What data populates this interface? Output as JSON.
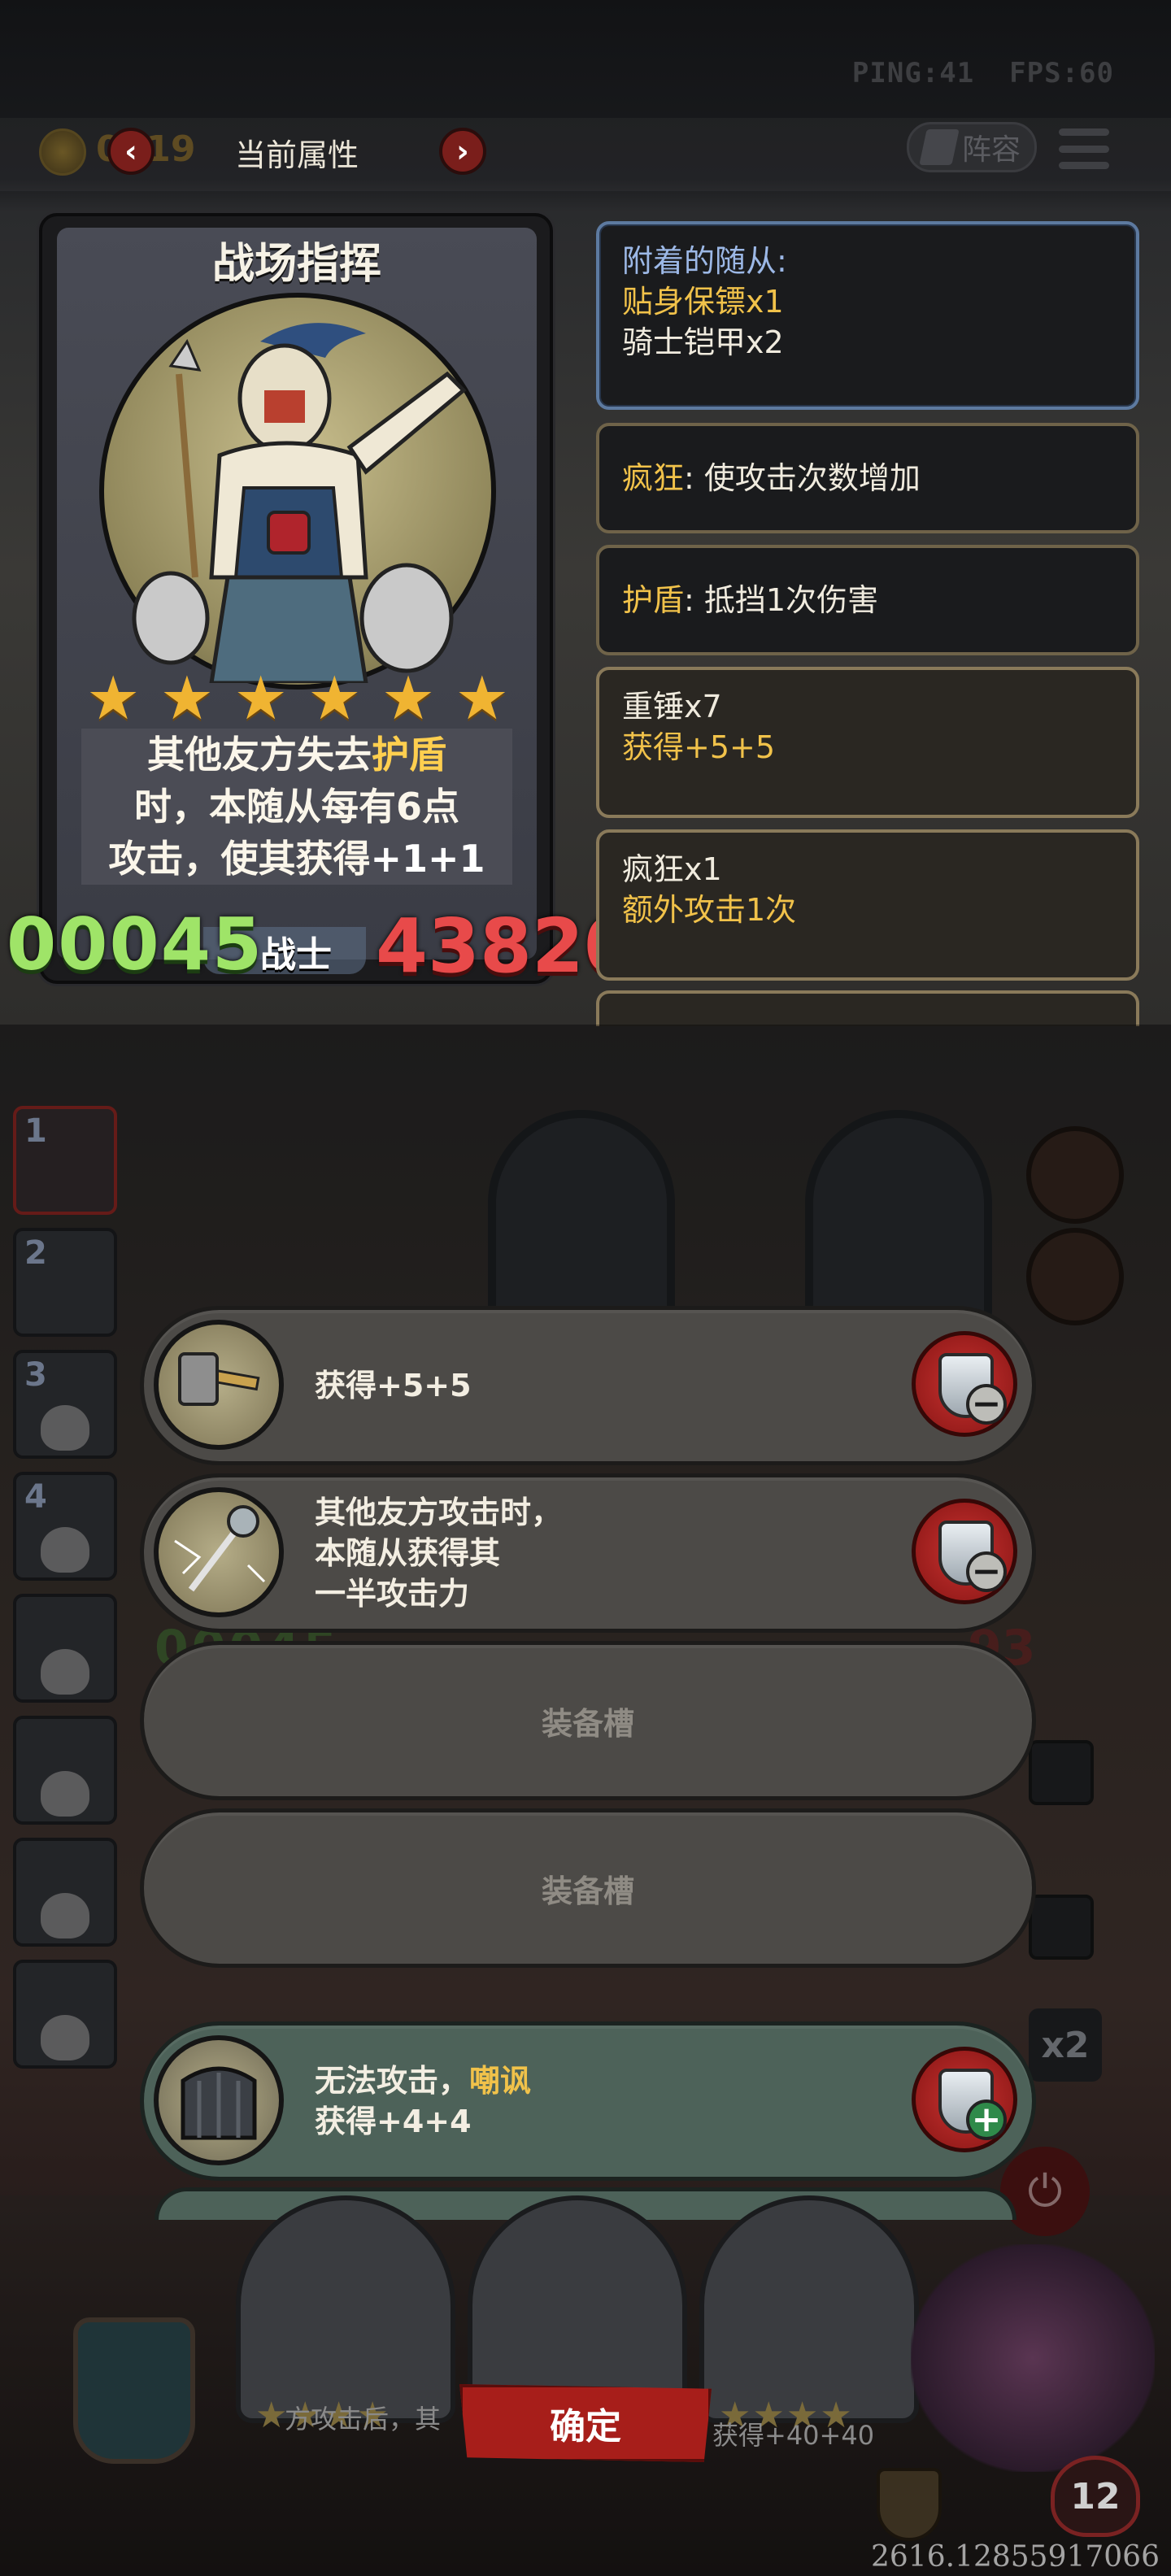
{
  "status": {
    "ping": "PING:41",
    "fps": "FPS:60"
  },
  "header": {
    "coin_value": "0019",
    "title": "当前属性",
    "prev_icon": "‹",
    "next_icon": "›",
    "lineup_label": "阵容"
  },
  "hero": {
    "name": "战场指挥",
    "stars": 6,
    "description": {
      "line1_a": "其他友方失去",
      "line1_b": "护盾",
      "line2": "时，本随从每有6点",
      "line3_a": "攻击，使其获得",
      "line3_b": "+1+1"
    },
    "attack": "00045",
    "class": "战士",
    "health": "43820"
  },
  "info_panels": {
    "attached_title": "附着的随从:",
    "attached_1": "贴身保镖x1",
    "attached_2": "骑士铠甲x2",
    "frenzy_key": "疯狂",
    "frenzy_desc": ": 使攻击次数增加",
    "shield_key": "护盾",
    "shield_desc": ": 抵挡1次伤害",
    "hammer_title": "重锤x7",
    "hammer_effect": "获得+5+5",
    "frenzy2_title": "疯狂x1",
    "frenzy2_effect": "额外攻击1次"
  },
  "roster": [
    "1",
    "2",
    "3",
    "4"
  ],
  "background": {
    "numbers_left": "00045",
    "numbers_right": "93",
    "x2_label": "x2",
    "power_icon": "⏻"
  },
  "equipment": {
    "slot1_text": "获得+5+5",
    "slot2_line1": "其他友方攻击时，",
    "slot2_line2": "本随从获得其",
    "slot2_line3": "一半攻击力",
    "empty_label": "装备槽",
    "slot5_line1_a": "无法攻击，",
    "slot5_line1_b": "嘲讽",
    "slot5_line2": "获得+4+4",
    "minus_sign": "−",
    "plus_sign": "+"
  },
  "bottom": {
    "text_left": "方攻击后，其",
    "text_right": "获得+40+40",
    "confirm": "确定",
    "heart_value": "12",
    "coordinates": "2616.12855917066"
  },
  "colors": {
    "accent_gold": "#f1c24a",
    "attack_green": "#9fe468",
    "health_red": "#e84a4a",
    "confirm_red": "#a71e1a"
  }
}
